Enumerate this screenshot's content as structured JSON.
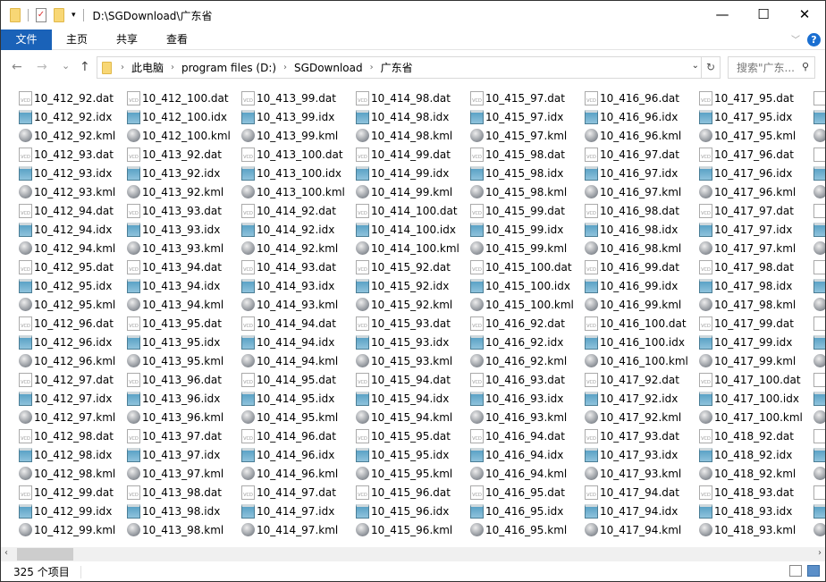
{
  "window": {
    "title": "D:\\SGDownload\\广东省",
    "minimize": "—",
    "maximize": "☐",
    "close": "✕"
  },
  "ribbon": {
    "tabs": [
      "文件",
      "主页",
      "共享",
      "查看"
    ],
    "help": "?",
    "expand": "﹀"
  },
  "nav": {
    "back": "←",
    "forward": "→",
    "recent": "⌄",
    "up": "↑",
    "breadcrumb": [
      "此电脑",
      "program files (D:)",
      "SGDownload",
      "广东省"
    ],
    "refresh": "↻",
    "search_placeholder": "搜索\"广东...",
    "search_icon": "⚲"
  },
  "files": [
    "10_412_92.dat",
    "10_412_92.idx",
    "10_412_92.kml",
    "10_412_93.dat",
    "10_412_93.idx",
    "10_412_93.kml",
    "10_412_94.dat",
    "10_412_94.idx",
    "10_412_94.kml",
    "10_412_95.dat",
    "10_412_95.idx",
    "10_412_95.kml",
    "10_412_96.dat",
    "10_412_96.idx",
    "10_412_96.kml",
    "10_412_97.dat",
    "10_412_97.idx",
    "10_412_97.kml",
    "10_412_98.dat",
    "10_412_98.idx",
    "10_412_98.kml",
    "10_412_99.dat",
    "10_412_99.idx",
    "10_412_99.kml",
    "10_412_100.dat",
    "10_412_100.idx",
    "10_412_100.kml",
    "10_413_92.dat",
    "10_413_92.idx",
    "10_413_92.kml",
    "10_413_93.dat",
    "10_413_93.idx",
    "10_413_93.kml",
    "10_413_94.dat",
    "10_413_94.idx",
    "10_413_94.kml",
    "10_413_95.dat",
    "10_413_95.idx",
    "10_413_95.kml",
    "10_413_96.dat",
    "10_413_96.idx",
    "10_413_96.kml",
    "10_413_97.dat",
    "10_413_97.idx",
    "10_413_97.kml",
    "10_413_98.dat",
    "10_413_98.idx",
    "10_413_98.kml",
    "10_413_99.dat",
    "10_413_99.idx",
    "10_413_99.kml",
    "10_413_100.dat",
    "10_413_100.idx",
    "10_413_100.kml",
    "10_414_92.dat",
    "10_414_92.idx",
    "10_414_92.kml",
    "10_414_93.dat",
    "10_414_93.idx",
    "10_414_93.kml",
    "10_414_94.dat",
    "10_414_94.idx",
    "10_414_94.kml",
    "10_414_95.dat",
    "10_414_95.idx",
    "10_414_95.kml",
    "10_414_96.dat",
    "10_414_96.idx",
    "10_414_96.kml",
    "10_414_97.dat",
    "10_414_97.idx",
    "10_414_97.kml",
    "10_414_98.dat",
    "10_414_98.idx",
    "10_414_98.kml",
    "10_414_99.dat",
    "10_414_99.idx",
    "10_414_99.kml",
    "10_414_100.dat",
    "10_414_100.idx",
    "10_414_100.kml",
    "10_415_92.dat",
    "10_415_92.idx",
    "10_415_92.kml",
    "10_415_93.dat",
    "10_415_93.idx",
    "10_415_93.kml",
    "10_415_94.dat",
    "10_415_94.idx",
    "10_415_94.kml",
    "10_415_95.dat",
    "10_415_95.idx",
    "10_415_95.kml",
    "10_415_96.dat",
    "10_415_96.idx",
    "10_415_96.kml",
    "10_415_97.dat",
    "10_415_97.idx",
    "10_415_97.kml",
    "10_415_98.dat",
    "10_415_98.idx",
    "10_415_98.kml",
    "10_415_99.dat",
    "10_415_99.idx",
    "10_415_99.kml",
    "10_415_100.dat",
    "10_415_100.idx",
    "10_415_100.kml",
    "10_416_92.dat",
    "10_416_92.idx",
    "10_416_92.kml",
    "10_416_93.dat",
    "10_416_93.idx",
    "10_416_93.kml",
    "10_416_94.dat",
    "10_416_94.idx",
    "10_416_94.kml",
    "10_416_95.dat",
    "10_416_95.idx",
    "10_416_95.kml",
    "10_416_96.dat",
    "10_416_96.idx",
    "10_416_96.kml",
    "10_416_97.dat",
    "10_416_97.idx",
    "10_416_97.kml",
    "10_416_98.dat",
    "10_416_98.idx",
    "10_416_98.kml",
    "10_416_99.dat",
    "10_416_99.idx",
    "10_416_99.kml",
    "10_416_100.dat",
    "10_416_100.idx",
    "10_416_100.kml",
    "10_417_92.dat",
    "10_417_92.idx",
    "10_417_92.kml",
    "10_417_93.dat",
    "10_417_93.idx",
    "10_417_93.kml",
    "10_417_94.dat",
    "10_417_94.idx",
    "10_417_94.kml",
    "10_417_95.dat",
    "10_417_95.idx",
    "10_417_95.kml",
    "10_417_96.dat",
    "10_417_96.idx",
    "10_417_96.kml",
    "10_417_97.dat",
    "10_417_97.idx",
    "10_417_97.kml",
    "10_417_98.dat",
    "10_417_98.idx",
    "10_417_98.kml",
    "10_417_99.dat",
    "10_417_99.idx",
    "10_417_99.kml",
    "10_417_100.dat",
    "10_417_100.idx",
    "10_417_100.kml",
    "10_418_92.dat",
    "10_418_92.idx",
    "10_418_92.kml",
    "10_418_93.dat",
    "10_418_93.idx",
    "10_418_93.kml"
  ],
  "icons": {
    "dat": "vcd-file-icon",
    "idx": "notepad-file-icon",
    "kml": "globe-file-icon",
    "dat_glyph": "VCD"
  },
  "scroll": {
    "left": "‹",
    "right": "›"
  },
  "status": {
    "count": "325 个项目"
  },
  "colors": {
    "accent": "#1a62b8"
  }
}
